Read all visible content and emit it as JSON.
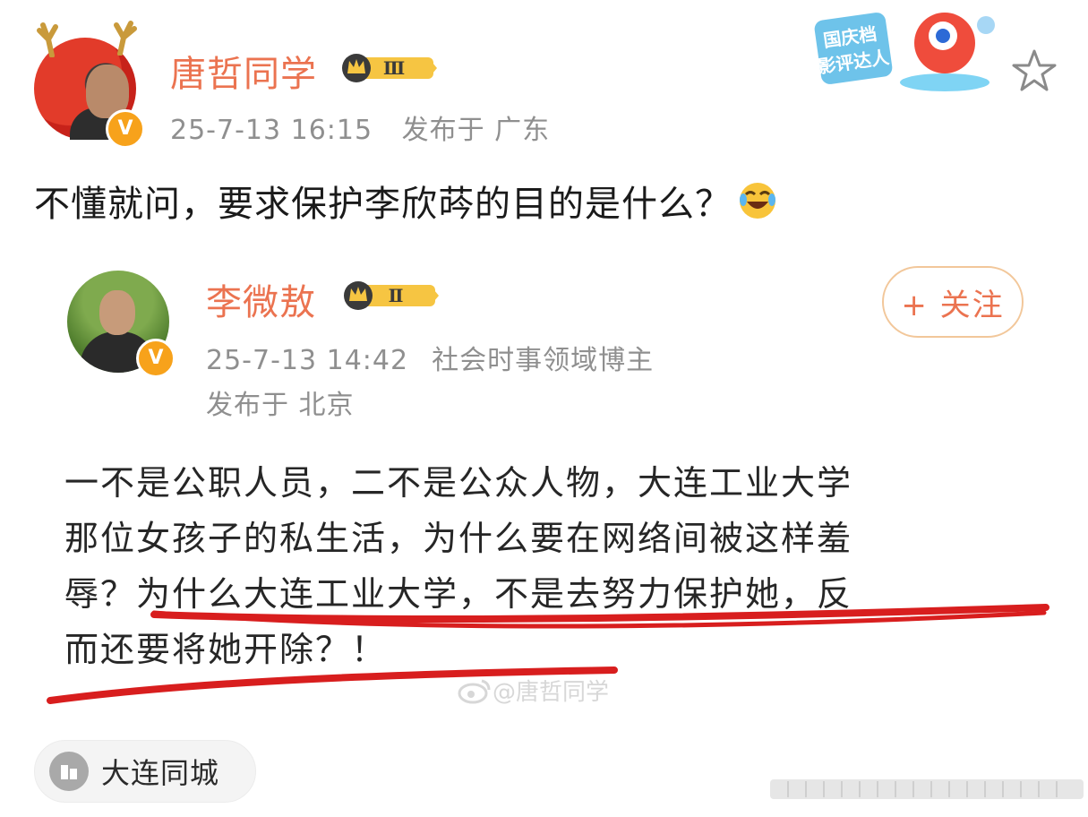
{
  "post": {
    "author_name": "唐哲同学",
    "vip_level": "Ⅲ",
    "timestamp": "25-7-13 16:15",
    "location": "发布于 广东",
    "text": "不懂就问，要求保护李欣荶的目的是什么？",
    "emoji": "laugh-cry-icon",
    "event_badge_line1": "国庆档",
    "event_badge_line2": "影评达人"
  },
  "quoted": {
    "author_name": "李微敖",
    "vip_level": "Ⅱ",
    "timestamp": "25-7-13 14:42",
    "author_tag": "社会时事领域博主",
    "location": "发布于 北京",
    "follow_label": "+ 关注",
    "text_line1": "一不是公职人员，二不是公众人物，大连工业大学",
    "text_line2": "那位女孩子的私生活，为什么要在网络间被这样羞",
    "text_line3a": "辱？",
    "text_line3b": "为什么大连工业大学，不是去努力保护她，反",
    "text_line4": "而还要将她开除？！",
    "underline_color": "#d81e1e"
  },
  "watermark": "@唐哲同学",
  "location_chip": {
    "label": "大连同城"
  },
  "colors": {
    "accent": "#eb7350",
    "verified": "#f7a21b",
    "meta": "#8f8f8f"
  }
}
